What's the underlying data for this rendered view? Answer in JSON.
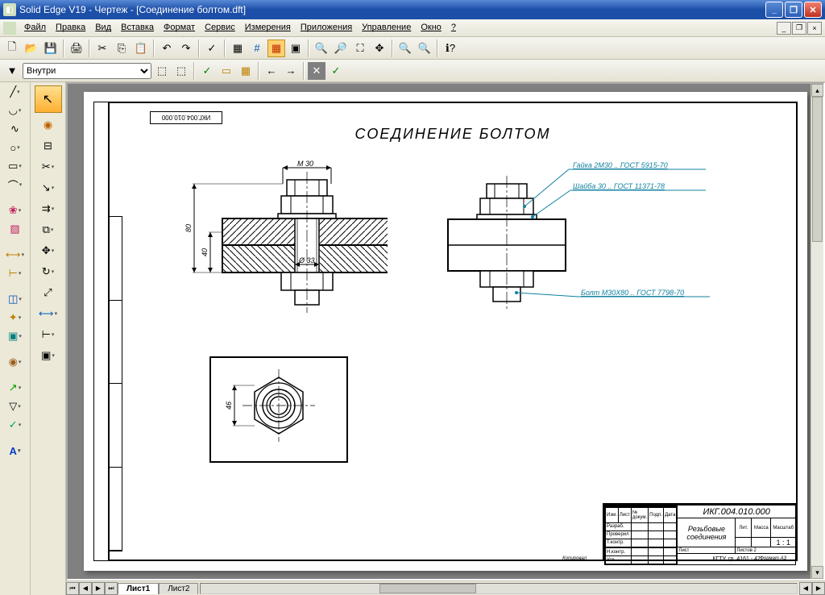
{
  "app": {
    "title": "Solid Edge V19 - Чертеж - [Соединение болтом.dft]"
  },
  "menu": {
    "file": "Файл",
    "edit": "Правка",
    "view": "Вид",
    "insert": "Вставка",
    "format": "Формат",
    "service": "Сервис",
    "measure": "Измерения",
    "apps": "Приложения",
    "manage": "Управление",
    "window": "Окно",
    "help": "?"
  },
  "ribbon": {
    "mode_select": "Внутри"
  },
  "sheets": {
    "s1": "Лист1",
    "s2": "Лист2"
  },
  "drawing": {
    "title": "СОЕДИНЕНИЕ БОЛТОМ",
    "stamp_code": "ИКГ.004.010.000",
    "dim_m30": "M 30",
    "dim_80": "80",
    "dim_40": "40",
    "dim_d33": "Ø 33",
    "dim_46": "46",
    "leader_nut": "Гайка 2М30 .. ГОСТ 5915-70",
    "leader_washer": "Шайба 30 .. ГОСТ 11371-78",
    "leader_bolt": "Болт М30Х80 .. ГОСТ 7798-70"
  },
  "titleblock": {
    "code": "ИКГ.004.010.000",
    "name": "Резьбовые соединения",
    "scale": "1 : 1",
    "sheet_label": "Лист",
    "sheets_label": "Листов",
    "mass_label": "Масса",
    "lit_label": "Лит.",
    "format_label": "Формат  А3",
    "org": "КГТУ, гр. 4161 - 42",
    "dev": "Разраб.",
    "check": "Проверил",
    "tcontr": "Т.контр.",
    "ncontr": "Н.контр.",
    "approve": "Утв.",
    "izm": "Изм.",
    "list_col": "Лист",
    "ndoc": "№ докум.",
    "sign": "Подп.",
    "date": "Дата",
    "copied": "Копировал"
  }
}
